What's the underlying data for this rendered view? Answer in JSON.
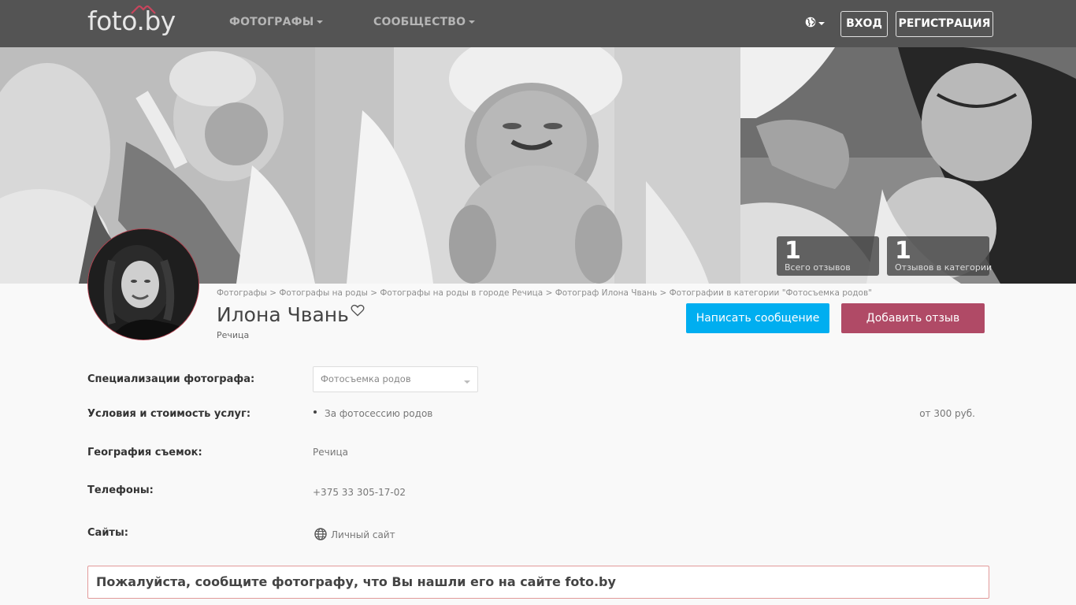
{
  "header": {
    "logo": "foto.by",
    "nav": [
      {
        "label": "ФОТОГРАФЫ"
      },
      {
        "label": "СООБЩЕСТВО"
      }
    ],
    "login_label": "ВХОД",
    "register_label": "РЕГИСТРАЦИЯ",
    "language_icon": "globe-icon"
  },
  "banner": {
    "stats": [
      {
        "value": "1",
        "label": "Всего отзывов"
      },
      {
        "value": "1",
        "label": "Отзывов в категории"
      }
    ]
  },
  "breadcrumb": [
    {
      "label": "Фотографы"
    },
    {
      "label": "Фотографы на роды"
    },
    {
      "label": "Фотографы на роды в городе Речица"
    },
    {
      "label": "Фотограф Илона Чвань"
    },
    {
      "label": "Фотографии в категории \"Фотосъемка родов\""
    }
  ],
  "profile": {
    "name": "Илона Чвань",
    "city": "Речица",
    "message_button": "Написать сообщение",
    "review_button": "Добавить отзыв"
  },
  "details": {
    "specializations_label": "Специализации фотографа:",
    "specialization_selected": "Фотосъемка родов",
    "services_label": "Условия и стоимость услуг:",
    "service_name": "За фотосессию родов",
    "service_price": "от 300 руб.",
    "geography_label": "География съемок:",
    "geography_value": "Речица",
    "phones_label": "Телефоны:",
    "phone_value": "+375 33 305-17-02",
    "sites_label": "Сайты:",
    "site_link": "Личный сайт"
  },
  "notice": "Пожалуйста, сообщите фотографу, что Вы нашли его на сайте foto.by",
  "colors": {
    "header_bg": "#545454",
    "message_button": "#00aef0",
    "review_button": "#b04a66",
    "notice_border": "#e29a9a"
  }
}
